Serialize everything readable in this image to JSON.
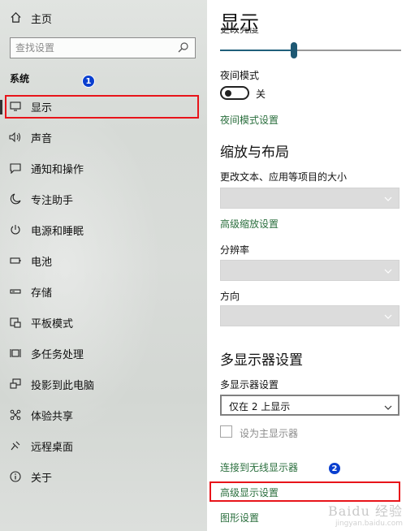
{
  "sidebar": {
    "home_label": "主页",
    "search_placeholder": "查找设置",
    "section_label": "系统",
    "items": [
      {
        "label": "显示",
        "icon": "monitor-icon"
      },
      {
        "label": "声音",
        "icon": "speaker-icon"
      },
      {
        "label": "通知和操作",
        "icon": "notification-icon"
      },
      {
        "label": "专注助手",
        "icon": "moon-icon"
      },
      {
        "label": "电源和睡眠",
        "icon": "power-icon"
      },
      {
        "label": "电池",
        "icon": "battery-icon"
      },
      {
        "label": "存储",
        "icon": "storage-icon"
      },
      {
        "label": "平板模式",
        "icon": "tablet-icon"
      },
      {
        "label": "多任务处理",
        "icon": "multitask-icon"
      },
      {
        "label": "投影到此电脑",
        "icon": "project-icon"
      },
      {
        "label": "体验共享",
        "icon": "share-icon"
      },
      {
        "label": "远程桌面",
        "icon": "remote-icon"
      },
      {
        "label": "关于",
        "icon": "info-icon"
      }
    ],
    "selected_index": 0
  },
  "annotations": {
    "badge_1": "1",
    "badge_2": "2"
  },
  "main": {
    "title": "显示",
    "truncated_label": "更改亮度",
    "brightness_level": 0.4,
    "night_mode_label": "夜间模式",
    "night_mode_state": "关",
    "night_mode_settings_link": "夜间模式设置",
    "scale_heading": "缩放与布局",
    "scale_label": "更改文本、应用等项目的大小",
    "advanced_scale_link": "高级缩放设置",
    "resolution_label": "分辨率",
    "orientation_label": "方向",
    "multi_heading": "多显示器设置",
    "multi_label": "多显示器设置",
    "multi_value": "仅在 2 上显示",
    "main_display_label": "设为主显示器",
    "wireless_link": "连接到无线显示器",
    "advanced_display_link": "高级显示设置",
    "graphics_link": "图形设置"
  },
  "colors": {
    "link": "#2b6f3e",
    "highlight": "#e8141a",
    "badge": "#0a3fcf",
    "slider": "#1e5873"
  },
  "watermark": {
    "main": "Baidu 经验",
    "sub": "jingyan.baidu.com"
  }
}
